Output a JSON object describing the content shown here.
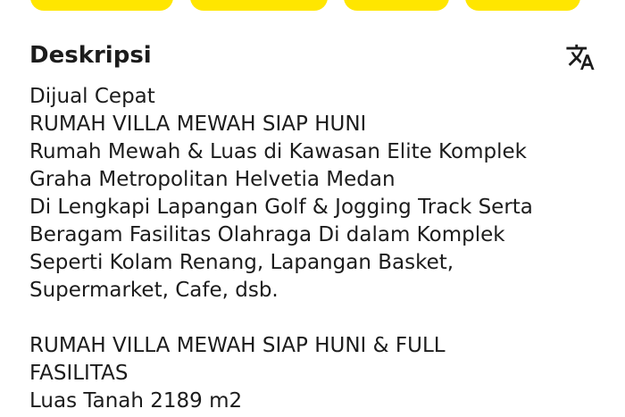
{
  "section": {
    "title": "Deskripsi",
    "translate_icon": "translate-icon"
  },
  "description": {
    "text": "Dijual Cepat\nRUMAH VILLA MEWAH SIAP HUNI\nRumah Mewah & Luas di Kawasan Elite Komplek\nGraha Metropolitan Helvetia Medan\nDi Lengkapi Lapangan Golf & Jogging Track Serta\nBeragam Fasilitas Olahraga Di dalam Komplek\nSeperti Kolam Renang, Lapangan Basket,\nSupermarket, Cafe, dsb.\n\nRUMAH VILLA MEWAH SIAP HUNI & FULL\nFASILITAS\nLuas Tanah 2189 m2"
  },
  "colors": {
    "chip": "#ffe600",
    "text": "#1c1c1c",
    "background": "#ffffff"
  }
}
